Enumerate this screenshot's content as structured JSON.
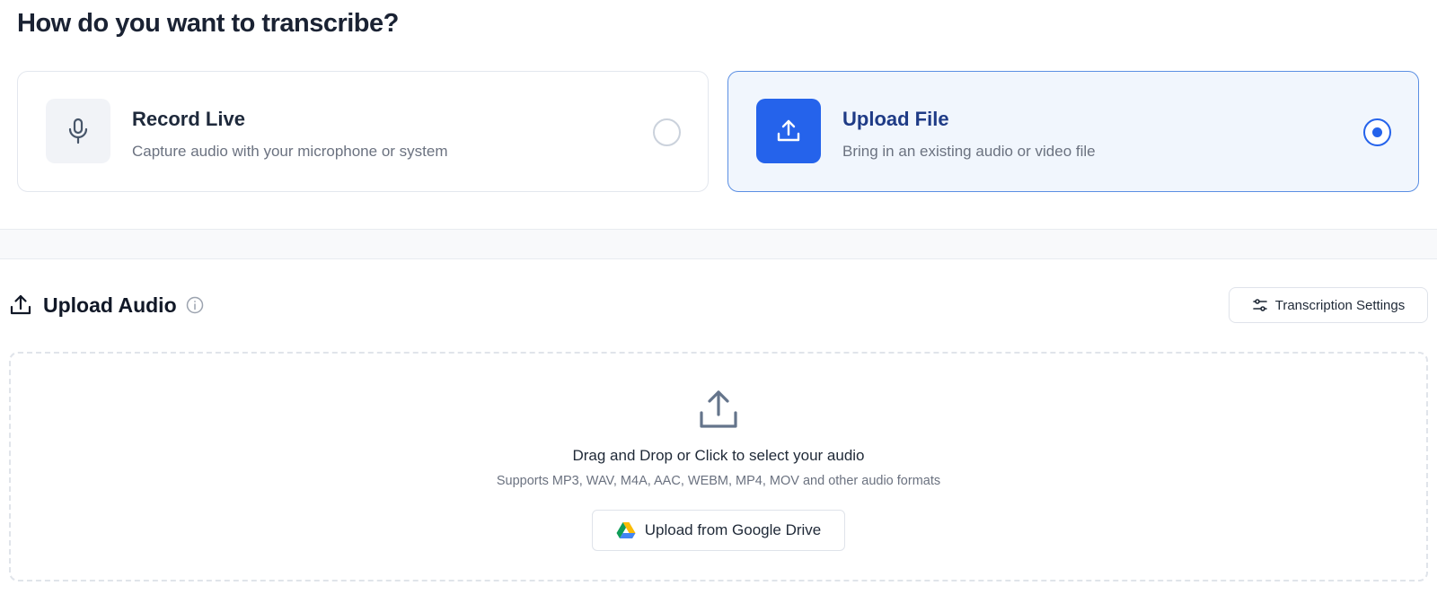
{
  "heading": "How do you want to transcribe?",
  "options": [
    {
      "title": "Record Live",
      "subtitle": "Capture audio with your microphone or system",
      "icon": "microphone-icon",
      "selected": false
    },
    {
      "title": "Upload File",
      "subtitle": "Bring in an existing audio or video file",
      "icon": "upload-icon",
      "selected": true
    }
  ],
  "upload_section": {
    "title": "Upload Audio",
    "settings_label": "Transcription Settings",
    "dropzone": {
      "title": "Drag and Drop or Click to select your audio",
      "subtitle": "Supports MP3, WAV, M4A, AAC, WEBM, MP4, MOV and other audio formats",
      "gdrive_label": "Upload from Google Drive"
    }
  },
  "colors": {
    "accent": "#2563eb",
    "selected_card_bg": "#f1f6fd",
    "selected_card_border": "#5b8fe3",
    "heading": "#1a2233",
    "muted_text": "#6b7280"
  }
}
